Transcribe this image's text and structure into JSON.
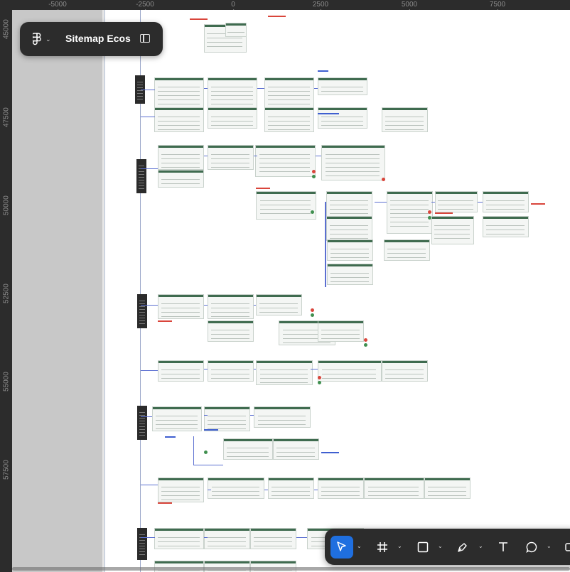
{
  "ruler": {
    "x_ticks": [
      "-5000",
      "-2500",
      "0",
      "2500",
      "5000",
      "7500"
    ],
    "y_ticks": [
      "45000",
      "47500",
      "50000",
      "52500",
      "55000",
      "57500"
    ]
  },
  "file": {
    "title": "Sitemap Ecos",
    "menu_icon": "figma-logo-icon",
    "panel_icon": "sidebar-toggle-icon"
  },
  "toolbar": {
    "tools": [
      {
        "name": "move",
        "icon": "cursor-icon",
        "active": true
      },
      {
        "name": "frame",
        "icon": "hash-frame-icon",
        "active": false
      },
      {
        "name": "shape",
        "icon": "rectangle-icon",
        "active": false
      },
      {
        "name": "pen",
        "icon": "pen-icon",
        "active": false
      },
      {
        "name": "text",
        "icon": "text-icon",
        "active": false
      },
      {
        "name": "comment",
        "icon": "speech-bubble-icon",
        "active": false
      }
    ]
  },
  "colors": {
    "accent": "#1f6fe0",
    "chrome": "#2c2c2c",
    "canvas": "#e6e6e6",
    "screen_header": "#3f6b4f",
    "connector": "#5b6fd1",
    "annotation_red": "#d9453b"
  }
}
